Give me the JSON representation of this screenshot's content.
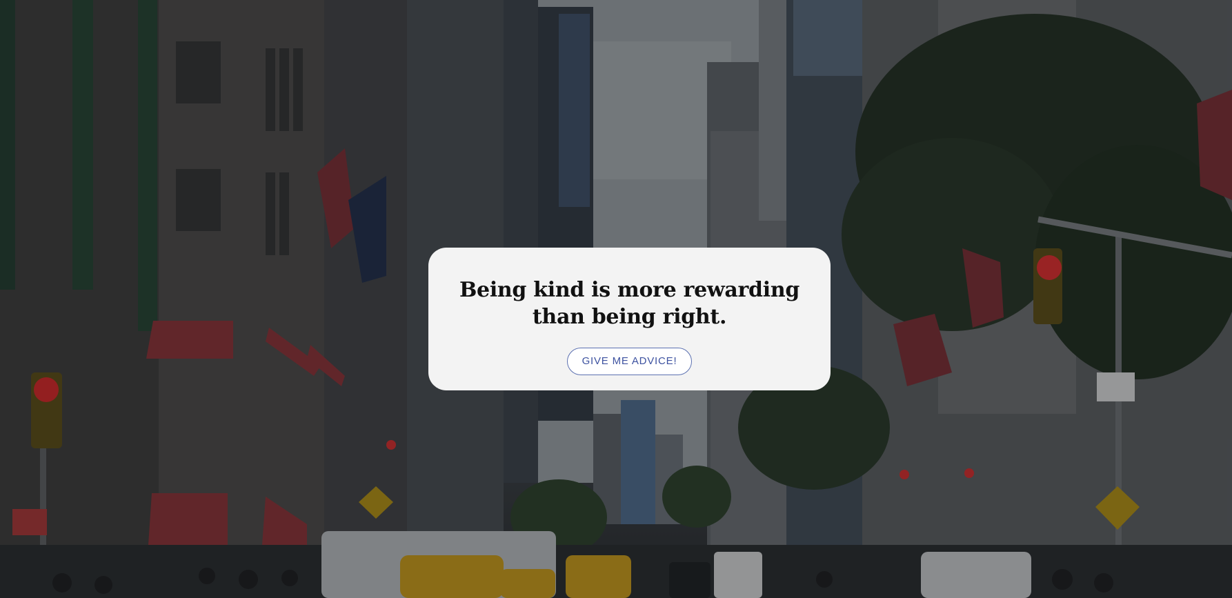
{
  "advice": {
    "text": "Being kind is more rewarding than being right."
  },
  "button": {
    "label": "GIVE ME ADVICE!"
  },
  "colors": {
    "card_background": "#f3f3f3",
    "button_border": "#5a6fb0",
    "button_text": "#3d52a0",
    "advice_text": "#111111"
  },
  "background": {
    "icon": "city-street-photo"
  }
}
